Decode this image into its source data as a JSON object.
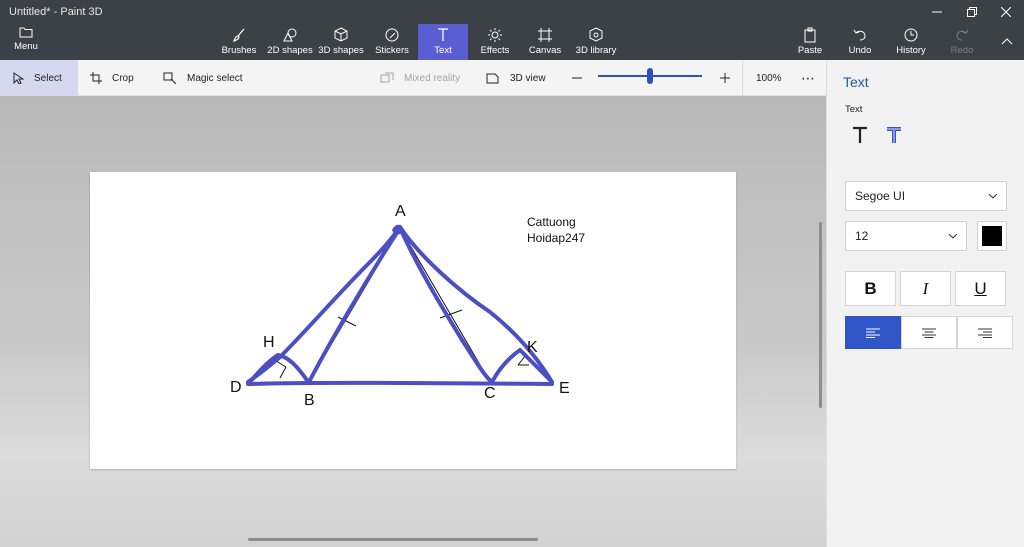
{
  "window": {
    "title": "Untitled* - Paint 3D"
  },
  "ribbon": {
    "menu_label": "Menu",
    "tools": [
      {
        "label": "Brushes"
      },
      {
        "label": "2D shapes"
      },
      {
        "label": "3D shapes"
      },
      {
        "label": "Stickers"
      },
      {
        "label": "Text"
      },
      {
        "label": "Effects"
      },
      {
        "label": "Canvas"
      },
      {
        "label": "3D library"
      }
    ],
    "actions": [
      {
        "label": "Paste"
      },
      {
        "label": "Undo"
      },
      {
        "label": "History"
      },
      {
        "label": "Redo"
      }
    ]
  },
  "toolbar": {
    "select_label": "Select",
    "crop_label": "Crop",
    "magic_select_label": "Magic select",
    "mixed_reality_label": "Mixed reality",
    "view3d_label": "3D view",
    "zoom_level": "100%",
    "zoom_fraction": 0.5
  },
  "canvas": {
    "labels": {
      "A": "A",
      "B": "B",
      "C": "C",
      "D": "D",
      "E": "E",
      "H": "H",
      "K": "K"
    },
    "text_line1": "Cattuong",
    "text_line2": "Hoidap247"
  },
  "panel": {
    "title": "Text",
    "section_label": "Text",
    "font_name": "Segoe UI",
    "font_size": "12",
    "text_color": "#000000",
    "bold_label": "B",
    "italic_label": "I",
    "underline_label": "U",
    "alignment": "left"
  },
  "colors": {
    "accent": "#5a5ed2",
    "stroke": "#4a4fc4",
    "title_bar": "#3c4047"
  }
}
